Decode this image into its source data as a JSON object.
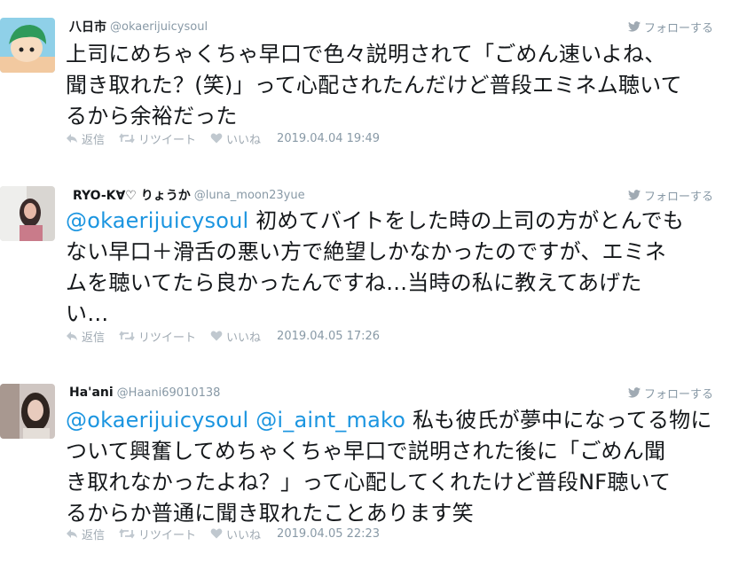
{
  "follow_label": "フォローする",
  "actions": {
    "reply": "返信",
    "retweet": "リツイート",
    "like": "いいね"
  },
  "tweets": [
    {
      "name": "八日市",
      "handle": "@okaerijuicysoul",
      "mentions": [],
      "text": "上司にめちゃくちゃ早口で色々説明されて「ごめん速いよね、\n聞き取れた？(笑)」って心配されたんだけど普段エミネム聴いて\nるから余裕だった",
      "date": "2019.04.04 19:49"
    },
    {
      "name": "RYO-K∀♡ りょうか",
      "handle": "@luna_moon23yue",
      "mentions": [
        "@okaerijuicysoul"
      ],
      "text": " 初めてバイトをした時の上司の方がとんでも\nない早口＋滑舌の悪い方で絶望しかなかったのですが、エミネ\nムを聴いてたら良かったんですね…当時の私に教えてあげた\nい…",
      "date": "2019.04.05 17:26"
    },
    {
      "name": "Ha'ani",
      "handle": "@Haani69010138",
      "mentions": [
        "@okaerijuicysoul",
        "@i_aint_mako"
      ],
      "text": " 私も彼氏が夢中になってる物に\nついて興奮してめちゃくちゃ早口で説明された後に「ごめん聞\nき取れなかったよね？」って心配してくれたけど普段NF聴いて\nるからか普通に聞き取れたことあります笑",
      "date": "2019.04.05 22:23"
    }
  ]
}
